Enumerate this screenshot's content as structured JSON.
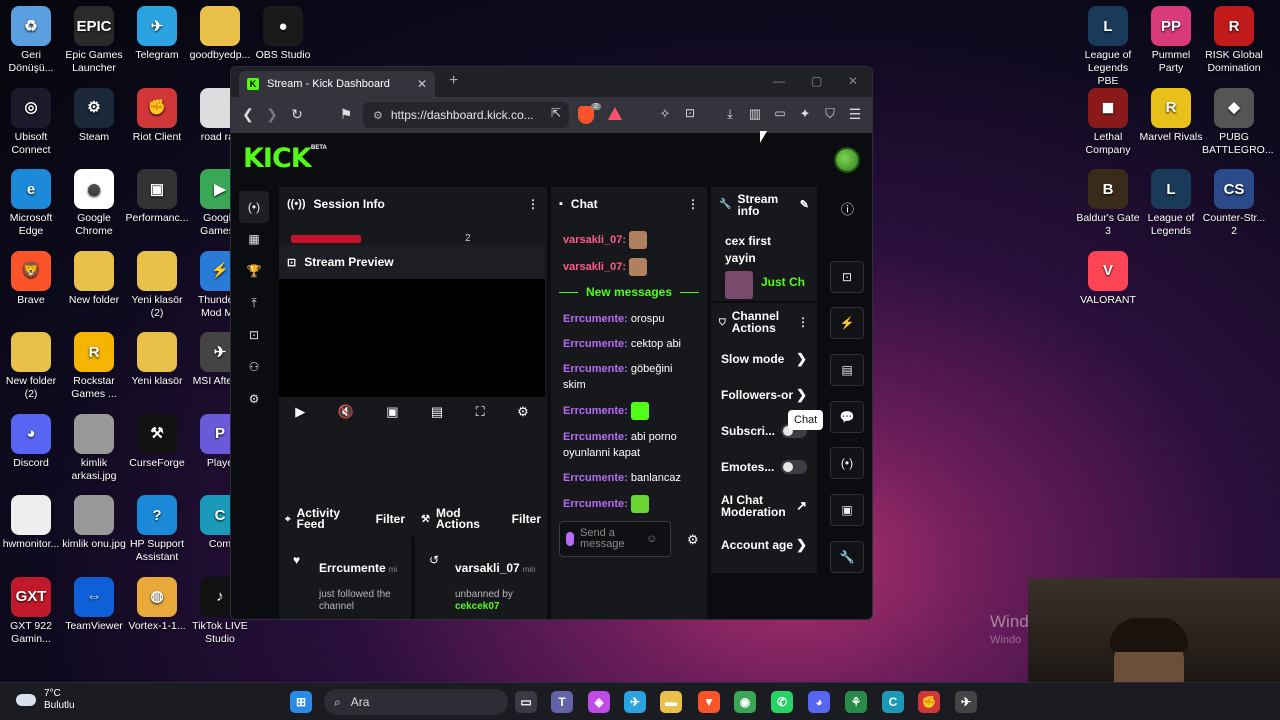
{
  "desktop": {
    "left_icons": [
      {
        "label": "Geri Dönüşü...",
        "color": "#5aa0e0",
        "glyph": "♻"
      },
      {
        "label": "Epic Games Launcher",
        "color": "#2a2a2a",
        "glyph": "EPIC"
      },
      {
        "label": "Telegram",
        "color": "#2aa3e0",
        "glyph": "✈"
      },
      {
        "label": "goodbyedp...",
        "color": "#e8c04a",
        "glyph": ""
      },
      {
        "label": "OBS Studio",
        "color": "#1a1a1a",
        "glyph": "●"
      },
      {
        "label": "Ubisoft Connect",
        "color": "#1a1a2a",
        "glyph": "◎"
      },
      {
        "label": "Steam",
        "color": "#1b2838",
        "glyph": "⚙"
      },
      {
        "label": "Riot Client",
        "color": "#d13639",
        "glyph": "✊"
      },
      {
        "label": "road ras",
        "color": "#dddddd",
        "glyph": ""
      },
      {
        "label": "Microsoft Edge",
        "color": "#1c8ad8",
        "glyph": "e"
      },
      {
        "label": "Google Chrome",
        "color": "#ffffff",
        "glyph": "◉"
      },
      {
        "label": "Performanc...",
        "color": "#333333",
        "glyph": "▣"
      },
      {
        "label": "Google Games I",
        "color": "#3aa757",
        "glyph": "▶"
      },
      {
        "label": "Brave",
        "color": "#fb542b",
        "glyph": "🦁"
      },
      {
        "label": "New folder",
        "color": "#e8c04a",
        "glyph": ""
      },
      {
        "label": "Yeni klasör (2)",
        "color": "#e8c04a",
        "glyph": ""
      },
      {
        "label": "Thunders Mod Ma",
        "color": "#2a7ad8",
        "glyph": "⚡"
      },
      {
        "label": "New folder (2)",
        "color": "#e8c04a",
        "glyph": ""
      },
      {
        "label": "Rockstar Games ...",
        "color": "#f4b400",
        "glyph": "R"
      },
      {
        "label": "Yeni klasör",
        "color": "#e8c04a",
        "glyph": ""
      },
      {
        "label": "MSI Afterbu",
        "color": "#444444",
        "glyph": "✈"
      },
      {
        "label": "Discord",
        "color": "#5865f2",
        "glyph": "◕"
      },
      {
        "label": "kimlik arkasi.jpg",
        "color": "#999999",
        "glyph": ""
      },
      {
        "label": "CurseForge",
        "color": "#111111",
        "glyph": "⚒"
      },
      {
        "label": "Playe",
        "color": "#6a5ad8",
        "glyph": "P"
      },
      {
        "label": "hwmonitor...",
        "color": "#eeeeee",
        "glyph": ""
      },
      {
        "label": "kimlik onu.jpg",
        "color": "#999999",
        "glyph": ""
      },
      {
        "label": "HP Support Assistant",
        "color": "#1a8ad8",
        "glyph": "?"
      },
      {
        "label": "Com",
        "color": "#1a9ab8",
        "glyph": "C"
      },
      {
        "label": "GXT 922 Gamin...",
        "color": "#c01a2a",
        "glyph": "GXT"
      },
      {
        "label": "TeamViewer",
        "color": "#0e5fd8",
        "glyph": "⇔"
      },
      {
        "label": "Vortex-1-1...",
        "color": "#e8a83a",
        "glyph": "◍"
      },
      {
        "label": "TikTok LIVE Studio",
        "color": "#111111",
        "glyph": "♪"
      }
    ],
    "right_icons": [
      {
        "label": "League of Legends PBE",
        "color": "#1a3a5a",
        "glyph": "L"
      },
      {
        "label": "Pummel Party",
        "color": "#d83a7a",
        "glyph": "PP"
      },
      {
        "label": "RISK Global Domination",
        "color": "#c01a1a",
        "glyph": "R"
      },
      {
        "label": "Lethal Company",
        "color": "#8a1a1a",
        "glyph": "◼"
      },
      {
        "label": "Marvel Rivals",
        "color": "#e8c01a",
        "glyph": "R"
      },
      {
        "label": "PUBG BATTLEGRO...",
        "color": "#555555",
        "glyph": "◆"
      },
      {
        "label": "Baldur's Gate 3",
        "color": "#3a2a1a",
        "glyph": "B"
      },
      {
        "label": "League of Legends",
        "color": "#1a3a5a",
        "glyph": "L"
      },
      {
        "label": "Counter-Str... 2",
        "color": "#2a4a8a",
        "glyph": "CS"
      },
      {
        "label": "VALORANT",
        "color": "#fd4556",
        "glyph": "V"
      }
    ],
    "watermark_line1": "Wind",
    "watermark_line2": "Windo"
  },
  "taskbar": {
    "temperature": "7°C",
    "weather": "Bulutlu",
    "search_placeholder": "Ara",
    "apps": [
      {
        "name": "start",
        "color": "#2a8ae8",
        "glyph": "⊞"
      },
      {
        "name": "taskview",
        "color": "#3a3a44",
        "glyph": "▭"
      },
      {
        "name": "teams",
        "color": "#6264a7",
        "glyph": "T"
      },
      {
        "name": "copilot",
        "color": "#c04ae8",
        "glyph": "◈"
      },
      {
        "name": "telegram",
        "color": "#2aa3e0",
        "glyph": "✈"
      },
      {
        "name": "explorer",
        "color": "#e8c04a",
        "glyph": "▬"
      },
      {
        "name": "brave",
        "color": "#fb542b",
        "glyph": "▼"
      },
      {
        "name": "chrome",
        "color": "#3aa757",
        "glyph": "◉"
      },
      {
        "name": "whatsapp",
        "color": "#25d366",
        "glyph": "✆"
      },
      {
        "name": "discord",
        "color": "#5865f2",
        "glyph": "◕"
      },
      {
        "name": "app-green",
        "color": "#2a8a4a",
        "glyph": "⚘"
      },
      {
        "name": "app-teal",
        "color": "#1a9ab8",
        "glyph": "C"
      },
      {
        "name": "riot",
        "color": "#d13639",
        "glyph": "✊"
      },
      {
        "name": "msi",
        "color": "#444444",
        "glyph": "✈"
      }
    ]
  },
  "browser": {
    "tab_title": "Stream - Kick Dashboard",
    "url": "https://dashboard.kick.co...",
    "shields_count": "2"
  },
  "kick": {
    "logo": "KICK",
    "beta": "BETA",
    "session_info": {
      "title": "Session Info",
      "stat": "2"
    },
    "stream_preview": {
      "title": "Stream Preview"
    },
    "activity_feed": {
      "title": "Activity Feed",
      "filter": "Filter",
      "user": "Errcumente",
      "user_suffix": "mi",
      "event": "just followed the channel"
    },
    "mod_actions": {
      "title": "Mod Actions",
      "filter": "Filter",
      "user": "varsakli_07",
      "user_suffix": "min",
      "event_prefix": "unbanned by",
      "moderator": "cekcek07"
    },
    "chat": {
      "title": "Chat",
      "new_messages": "New messages",
      "messages": [
        {
          "user": "varsakli_07",
          "text": "",
          "emote": "#b08060"
        },
        {
          "user": "varsakli_07",
          "text": "",
          "emote": "#b08060"
        }
      ],
      "new": [
        {
          "user": "Errcumente",
          "text": "orospu"
        },
        {
          "user": "Errcumente",
          "text": "cektop abi"
        },
        {
          "user": "Errcumente",
          "text": "göbeğini skim"
        },
        {
          "user": "Errcumente",
          "text": "",
          "emote": "#53fc18"
        },
        {
          "user": "Errcumente",
          "text": "abi porno oyunlanni kapat"
        },
        {
          "user": "Errcumente",
          "text": "banlancaz"
        },
        {
          "user": "Errcumente",
          "text": "",
          "emote": "#6ad832"
        }
      ],
      "input_placeholder": "Send a message"
    },
    "stream_info": {
      "title": "Stream info",
      "stream_title": "cex first yayin",
      "category": "Just Ch"
    },
    "channel_actions": {
      "title": "Channel Actions",
      "items": [
        {
          "label": "Slow mode",
          "kind": "chevron"
        },
        {
          "label": "Followers-or",
          "kind": "chevron"
        },
        {
          "label": "Subscri...",
          "kind": "toggle"
        },
        {
          "label": "Emotes...",
          "kind": "toggle"
        },
        {
          "label": "AI Chat Moderation",
          "kind": "external"
        },
        {
          "label": "Account age",
          "kind": "chevron"
        }
      ]
    },
    "tooltip": "Chat"
  }
}
